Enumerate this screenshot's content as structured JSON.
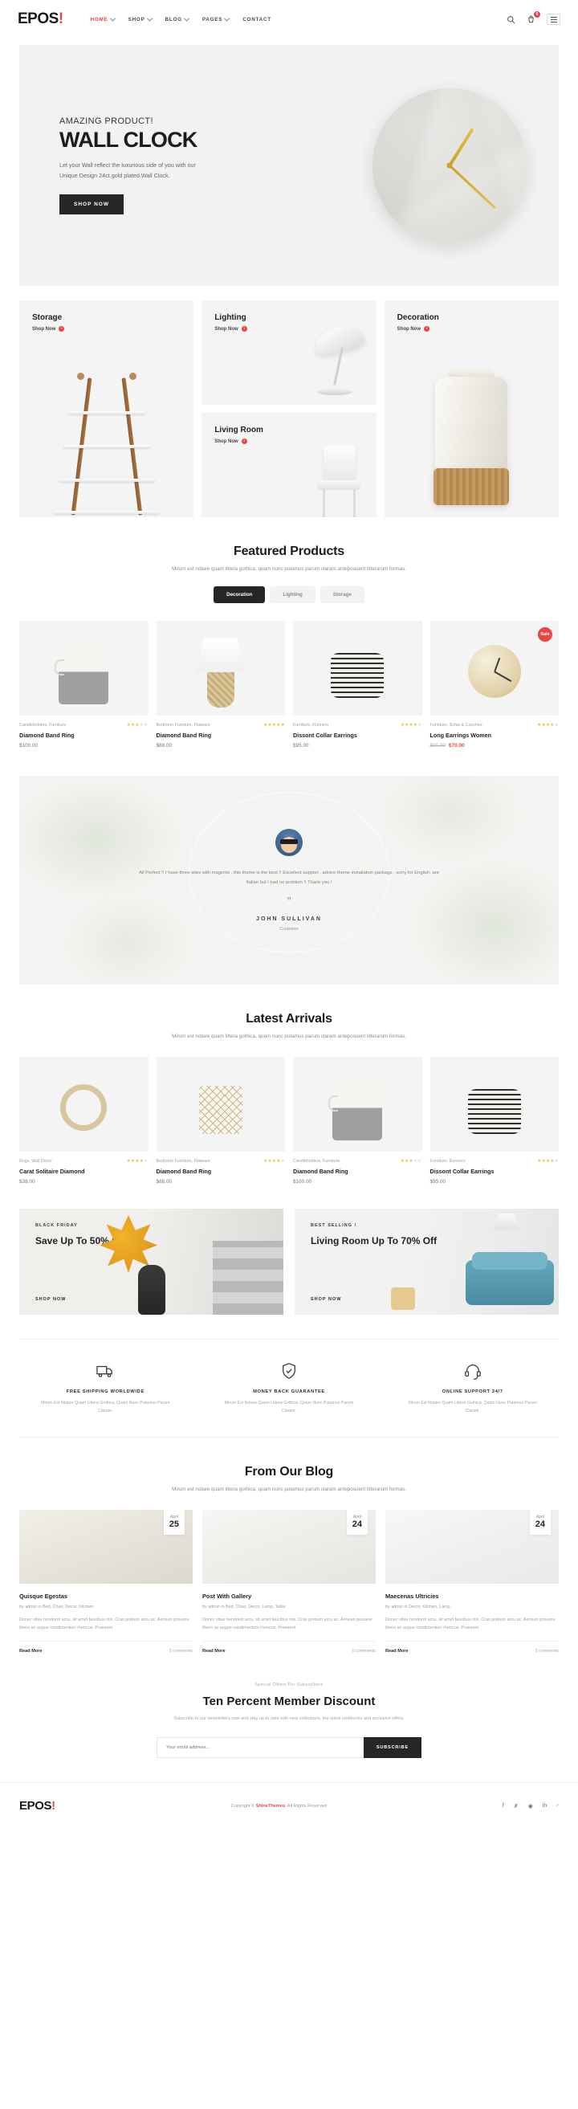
{
  "header": {
    "logo": "EPOS",
    "logo_bang": "!",
    "nav": [
      {
        "label": "HOME",
        "caret": true,
        "active": true
      },
      {
        "label": "SHOP",
        "caret": true,
        "active": false
      },
      {
        "label": "BLOG",
        "caret": true,
        "active": false
      },
      {
        "label": "PAGES",
        "caret": true,
        "active": false
      },
      {
        "label": "CONTACT",
        "caret": false,
        "active": false
      }
    ],
    "search_icon": "search-icon",
    "cart_icon": "cart-icon",
    "cart_count": "0",
    "menu_icon": "hamburger-icon"
  },
  "hero": {
    "kicker": "AMAZING PRODUCT!",
    "title": "WALL CLOCK",
    "desc": "Let your Wall reflect the luxurious side of you with our Unique Design 24ct.gold plated Wall Clock.",
    "cta": "SHOP NOW"
  },
  "categories": [
    {
      "title": "Storage",
      "link": "Shop Now",
      "art": "shelf"
    },
    {
      "title": "Lighting",
      "link": "Shop Now",
      "art": "lamp"
    },
    {
      "title": "Living Room",
      "link": "Shop Now",
      "art": "chair"
    },
    {
      "title": "Decoration",
      "link": "Shop Now",
      "art": "vase"
    }
  ],
  "featured": {
    "title": "Featured Products",
    "subtitle": "Mirum est notare quam littera gothica, quam nunc putamus parum claram anteposuerit litterarum formas.",
    "tabs": [
      {
        "label": "Decoration",
        "active": true
      },
      {
        "label": "Lighting",
        "active": false
      },
      {
        "label": "Storage",
        "active": false
      }
    ],
    "products": [
      {
        "category": "Candleholders, Furniture",
        "name": "Diamond Band Ring",
        "price": "$100.00",
        "old_price": "",
        "stars": 3,
        "sale": false,
        "badge": "",
        "art": "basket"
      },
      {
        "category": "Bedroom Furniture, Flatware",
        "name": "Diamond Band Ring",
        "price": "$88.00",
        "old_price": "",
        "stars": 5,
        "sale": false,
        "badge": "",
        "art": "lamp"
      },
      {
        "category": "Furniture, Runners",
        "name": "Dissont Collar Earrings",
        "price": "$95.00",
        "old_price": "",
        "stars": 4,
        "sale": false,
        "badge": "",
        "art": "pouf"
      },
      {
        "category": "Furniture, Sofas & Couches",
        "name": "Long Earrings Women",
        "price": "$70.00",
        "old_price": "$80.00",
        "stars": 4,
        "sale": true,
        "badge": "Sale",
        "art": "clock"
      }
    ]
  },
  "testimonial": {
    "quote": "All Perfect !! I have three sites with magento , this theme is the best !! Excellent support , advice theme installation package , sorry for English, are Italian but I had no problem !! Thank you !",
    "quote_mark": "”",
    "name": "JOHN SULLIVAN",
    "role": "Customer"
  },
  "arrivals": {
    "title": "Latest Arrivals",
    "subtitle": "Mirum est notare quam littera gothica, quam nunc putamus parum claram anteposuerit litterarum formas.",
    "products": [
      {
        "category": "Rugs, Wall Decor",
        "name": "Carat Solitaire Diamond",
        "price": "$38.00",
        "old_price": "",
        "stars": 4,
        "art": "ring"
      },
      {
        "category": "Bedroom Furniture, Flatware",
        "name": "Diamond Band Ring",
        "price": "$88.00",
        "old_price": "",
        "stars": 4,
        "art": "net"
      },
      {
        "category": "Candleholders, Furniture",
        "name": "Diamond Band Ring",
        "price": "$100.00",
        "old_price": "",
        "stars": 3,
        "art": "basket"
      },
      {
        "category": "Furniture, Runners",
        "name": "Dissont Collar Earrings",
        "price": "$95.00",
        "old_price": "",
        "stars": 4,
        "art": "pouf"
      }
    ]
  },
  "promos": [
    {
      "kicker": "BLACK FRIDAY",
      "title": "Save Up To\n50% Off",
      "cta": "SHOP NOW"
    },
    {
      "kicker": "BEST SELLING !",
      "title": "Living Room\nUp To 70% Off",
      "cta": "SHOP NOW"
    }
  ],
  "services": [
    {
      "icon": "truck-icon",
      "title": "FREE SHIPPING WORLDWIDE",
      "desc": "Mirum Est Notare Quam Littera Gothica, Quam Nunc Putamus Parum Claram."
    },
    {
      "icon": "shield-hand-icon",
      "title": "MONEY BACK GUARANTEE",
      "desc": "Mirum Est Notare Quam Littera Gothica, Quam Nunc Putamus Parum Claram."
    },
    {
      "icon": "headset-icon",
      "title": "ONLINE SUPPORT 24/7",
      "desc": "Mirum Est Notare Quam Littera Gothica, Quam Nunc Putamus Parum Claram."
    }
  ],
  "blog": {
    "title": "From Our Blog",
    "subtitle": "Mirum est notare quam littera gothica, quam nunc putamus parum claram anteposuerit litterarum formas.",
    "posts": [
      {
        "month": "April",
        "day": "25",
        "title": "Quisque Egestas",
        "by": "by admin in Bed, Chair, Decor, Kitchen",
        "excerpt": "Donec vitae hendrerit arcu, sit amet faucibus nisi. Cras pretium arcu ac. Aenean posuere libero ac augue condimentum rhoncus. Praesent",
        "read_more": "Read More",
        "comments": "0 comments"
      },
      {
        "month": "April",
        "day": "24",
        "title": "Post With Gallery",
        "by": "by admin in Bed, Chair, Decor, Lamp, Table",
        "excerpt": "Donec vitae hendrerit arcu, sit amet faucibus nisi. Cras pretium arcu ac. Aenean posuere libero ac augue condimentum rhoncus. Praesent",
        "read_more": "Read More",
        "comments": "0 comments"
      },
      {
        "month": "April",
        "day": "24",
        "title": "Maecenas Ultricies",
        "by": "by admin in Decor, Kitchen, Lamp",
        "excerpt": "Donec vitae hendrerit arcu, sit amet faucibus nisi. Cras pretium arcu ac. Aenean posuere libero ac augue condimentum rhoncus. Praesent",
        "read_more": "Read More",
        "comments": "0 comments"
      }
    ]
  },
  "newsletter": {
    "kicker": "Special Offers For Subscribers",
    "title": "Ten Percent Member Discount",
    "subtitle": "Subscribe to our newsletters now and stay up to date with new collections, the latest lookbooks and exclusive offers.",
    "placeholder": "Your email address...",
    "button": "SUBSCRIBE"
  },
  "footer": {
    "logo": "EPOS",
    "logo_bang": "!",
    "copyright_pre": "Copyright © ",
    "copyright_brand": "ShineThemes",
    "copyright_post": ". All Rights Reserved",
    "socials": [
      "facebook-icon",
      "twitter-icon",
      "instagram-icon",
      "linkedin-icon",
      "rss-icon"
    ]
  },
  "colors": {
    "accent": "#e94545",
    "dark": "#262626",
    "star": "#f0bc28"
  }
}
